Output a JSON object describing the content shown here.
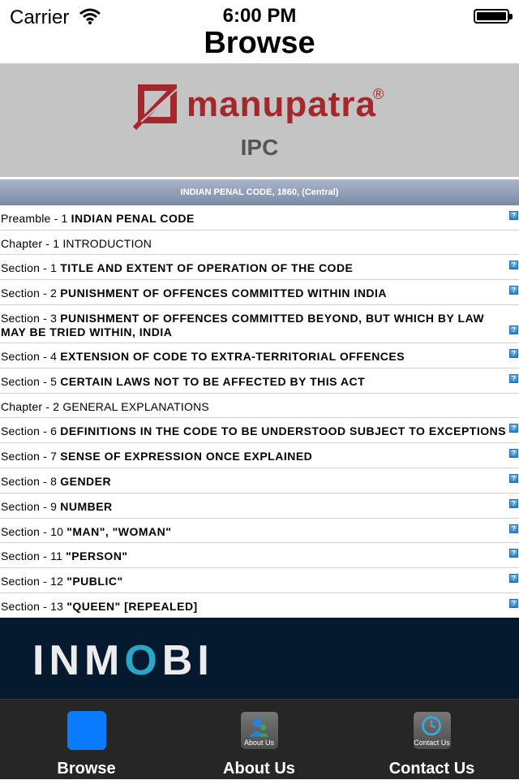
{
  "status_bar": {
    "carrier": "Carrier",
    "time": "6:00 PM"
  },
  "nav": {
    "title": "Browse"
  },
  "banner": {
    "brand": "manupatra",
    "reg": "®",
    "subtitle": "IPC"
  },
  "header": "INDIAN PENAL CODE, 1860,  (Central)",
  "rows": [
    {
      "prefix": "Preamble - 1",
      "title": "INDIAN PENAL CODE",
      "bold": true,
      "info": true,
      "height": 31
    },
    {
      "prefix": "Chapter - 1",
      "title": " INTRODUCTION",
      "bold": false,
      "info": false,
      "height": 30
    },
    {
      "prefix": "Section - 1",
      "title": "TITLE AND EXTENT OF OPERATION OF THE CODE",
      "bold": true,
      "info": true,
      "height": 31
    },
    {
      "prefix": "Section - 2",
      "title": "PUNISHMENT OF OFFENCES COMMITTED WITHIN INDIA",
      "bold": true,
      "info": true,
      "height": 31
    },
    {
      "prefix": "Section - 3",
      "title": "PUNISHMENT OF OFFENCES COMMITTED BEYOND, BUT WHICH BY LAW MAY BE TRIED WITHIN, INDIA",
      "bold": true,
      "info": true,
      "height": 47
    },
    {
      "prefix": "Section - 4",
      "title": "EXTENSION OF CODE TO EXTRA-TERRITORIAL OFFENCES",
      "bold": true,
      "info": true,
      "height": 31
    },
    {
      "prefix": "Section - 5",
      "title": "CERTAIN LAWS NOT TO BE AFFECTED BY THIS ACT",
      "bold": true,
      "info": true,
      "height": 31
    },
    {
      "prefix": "Chapter - 2",
      "title": " GENERAL EXPLANATIONS",
      "bold": false,
      "info": false,
      "height": 30
    },
    {
      "prefix": "Section - 6",
      "title": "DEFINITIONS IN THE CODE TO BE UNDERSTOOD SUBJECT TO EXCEPTIONS",
      "bold": true,
      "info": true,
      "height": 31
    },
    {
      "prefix": "Section - 7",
      "title": "SENSE OF EXPRESSION ONCE EXPLAINED",
      "bold": true,
      "info": true,
      "height": 31
    },
    {
      "prefix": "Section - 8",
      "title": "GENDER",
      "bold": true,
      "info": true,
      "height": 31
    },
    {
      "prefix": "Section - 9",
      "title": "NUMBER",
      "bold": true,
      "info": true,
      "height": 31
    },
    {
      "prefix": "Section - 10",
      "title": "\"MAN\", \"WOMAN\"",
      "bold": true,
      "info": true,
      "height": 30
    },
    {
      "prefix": "Section - 11",
      "title": "\"PERSON\"",
      "bold": true,
      "info": true,
      "height": 31
    },
    {
      "prefix": "Section - 12",
      "title": "\"PUBLIC\"",
      "bold": true,
      "info": true,
      "height": 31
    },
    {
      "prefix": "Section - 13",
      "title": "\"QUEEN\" [REPEALED]",
      "bold": true,
      "info": true,
      "height": 31
    }
  ],
  "info_glyph": "?",
  "ad": {
    "brand_a": "INM",
    "brand_o": "O",
    "brand_b": "BI"
  },
  "tabs": [
    {
      "label": "Browse",
      "caption": "",
      "icon": "browse-icon"
    },
    {
      "label": "About Us",
      "caption": "About Us",
      "icon": "user-icon"
    },
    {
      "label": "Contact Us",
      "caption": "Contact Us",
      "icon": "clock-icon"
    }
  ],
  "colors": {
    "brand": "#a3272b",
    "tab_active": "#0a7bff",
    "ad_bg": "#051a2f"
  }
}
